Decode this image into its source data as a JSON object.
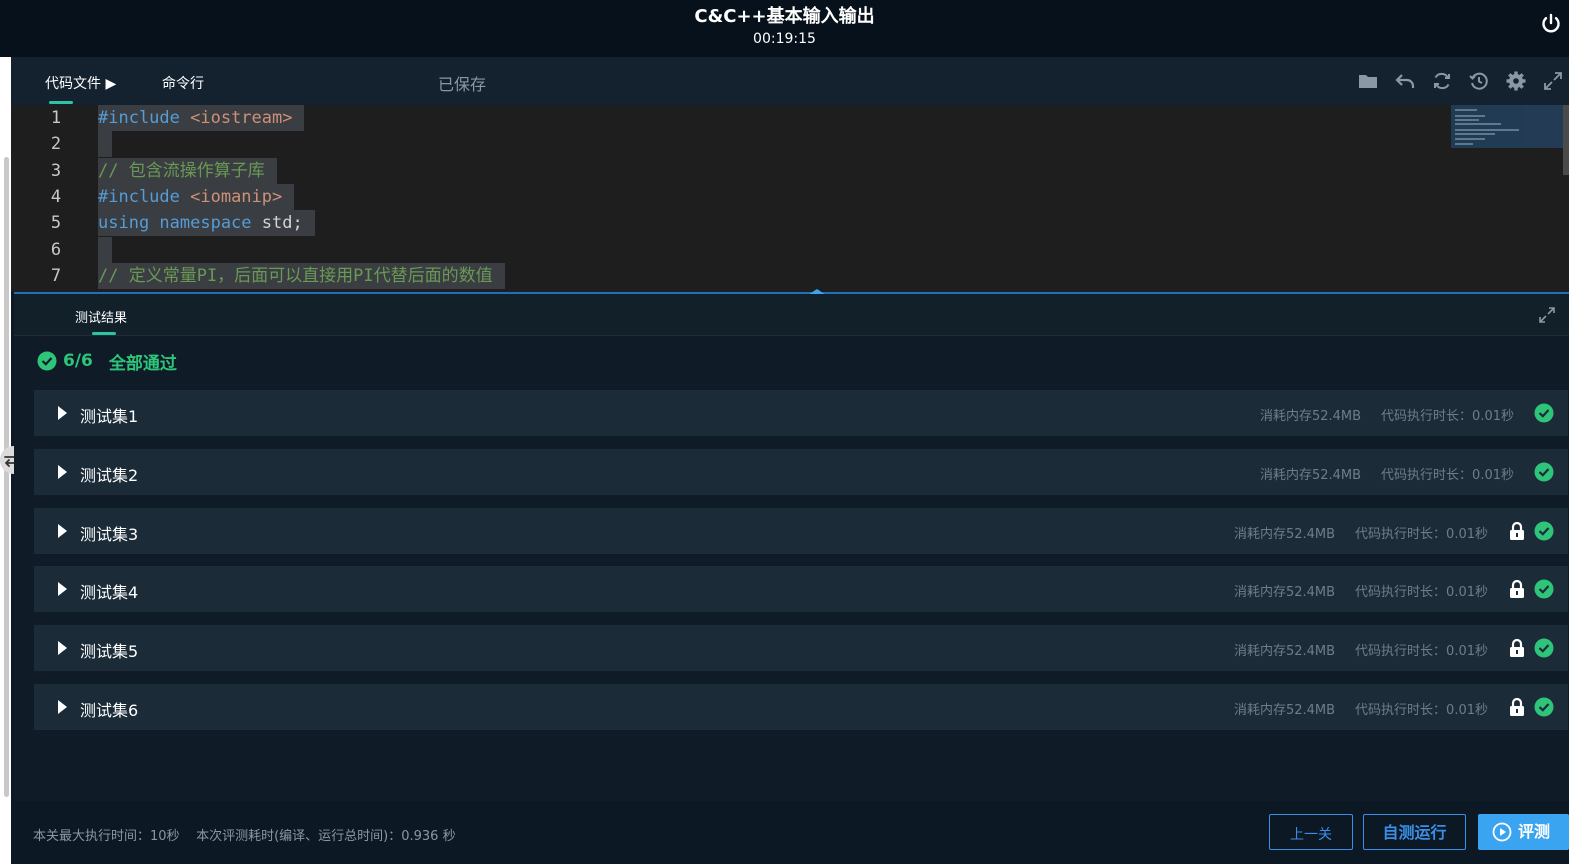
{
  "header": {
    "title": "C&C++基本输入输出",
    "timer": "00:19:15"
  },
  "editor": {
    "tabs": [
      "代码文件 ▶",
      "命令行"
    ],
    "status": "已保存",
    "lines": [
      {
        "num": "1",
        "parts": [
          {
            "t": "#include ",
            "c": "kw"
          },
          {
            "t": "<iostream>",
            "c": "str"
          }
        ]
      },
      {
        "num": "2",
        "parts": []
      },
      {
        "num": "3",
        "parts": [
          {
            "t": "// 包含流操作算子库",
            "c": "cm"
          }
        ]
      },
      {
        "num": "4",
        "parts": [
          {
            "t": "#include ",
            "c": "kw"
          },
          {
            "t": "<iomanip>",
            "c": "str"
          }
        ]
      },
      {
        "num": "5",
        "parts": [
          {
            "t": "using namespace ",
            "c": "kw"
          },
          {
            "t": "std;",
            "c": "plain"
          }
        ]
      },
      {
        "num": "6",
        "parts": []
      },
      {
        "num": "7",
        "parts": [
          {
            "t": "// 定义常量PI，后面可以直接用PI代替后面的数值",
            "c": "cm"
          }
        ]
      }
    ]
  },
  "results": {
    "tab": "测试结果",
    "score": "6/6",
    "summary": "全部通过",
    "tests": [
      {
        "name": "测试集1",
        "memory": "消耗内存52.4MB",
        "time": "代码执行时长：0.01秒",
        "locked": false
      },
      {
        "name": "测试集2",
        "memory": "消耗内存52.4MB",
        "time": "代码执行时长：0.01秒",
        "locked": false
      },
      {
        "name": "测试集3",
        "memory": "消耗内存52.4MB",
        "time": "代码执行时长：0.01秒",
        "locked": true
      },
      {
        "name": "测试集4",
        "memory": "消耗内存52.4MB",
        "time": "代码执行时长：0.01秒",
        "locked": true
      },
      {
        "name": "测试集5",
        "memory": "消耗内存52.4MB",
        "time": "代码执行时长：0.01秒",
        "locked": true
      },
      {
        "name": "测试集6",
        "memory": "消耗内存52.4MB",
        "time": "代码执行时长：0.01秒",
        "locked": true
      }
    ]
  },
  "footer": {
    "info": "本关最大执行时间：10秒    本次评测耗时(编译、运行总时间)：0.936 秒",
    "prev_label": "上一关",
    "self_test_label": "自测运行",
    "evaluate_label": "评测"
  },
  "colors": {
    "accent": "#3aa4f0",
    "pass": "#2ec47a",
    "tab_indicator": "#2ec4a0"
  }
}
